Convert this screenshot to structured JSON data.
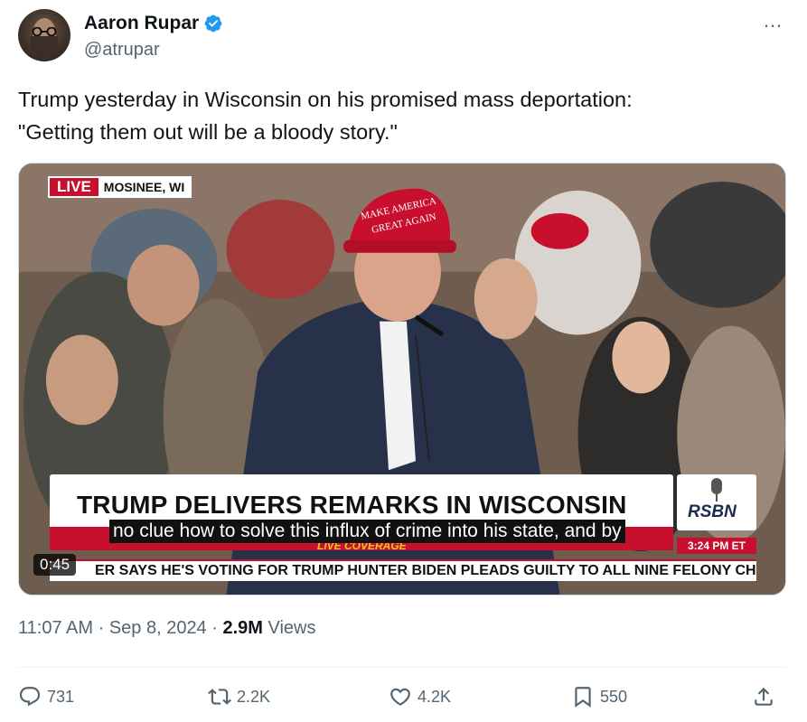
{
  "author": {
    "name": "Aaron Rupar",
    "handle": "@atrupar",
    "verified_color": "#1d9bf0"
  },
  "more_icon": "…",
  "tweet": {
    "line1": "Trump yesterday in Wisconsin on his promised mass deportation:",
    "line2": "\"Getting them out will be a bloody story.\""
  },
  "video": {
    "live_label": "LIVE",
    "location": "MOSINEE, WI",
    "headline": "TRUMP DELIVERS REMARKS IN WISCONSIN",
    "live_coverage": "LIVE COVERAGE",
    "caption": "no clue how to solve this influx of crime into his state, and by",
    "network": "RSBN",
    "time": "3:24 PM ET",
    "ticker": "ER SAYS HE'S VOTING FOR TRUMP     HUNTER BIDEN PLEADS GUILTY TO ALL NINE FELONY CH",
    "duration": "0:45",
    "hat_text_1": "MAKE AMERICA",
    "hat_text_2": "GREAT AGAIN"
  },
  "meta": {
    "time": "11:07 AM",
    "sep1": " · ",
    "date": "Sep 8, 2024",
    "sep2": " · ",
    "views_count": "2.9M",
    "views_label": " Views"
  },
  "actions": {
    "replies": "731",
    "reposts": "2.2K",
    "likes": "4.2K",
    "bookmarks": "550"
  },
  "colors": {
    "accent": "#1d9bf0",
    "text_secondary": "#536471",
    "broadcast_red": "#c8102e"
  }
}
